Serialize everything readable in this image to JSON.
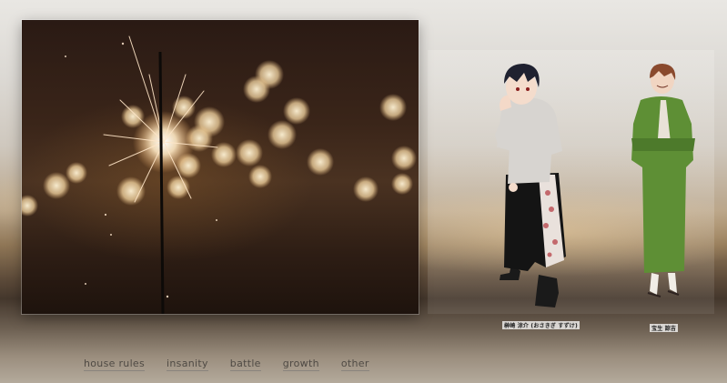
{
  "nav": {
    "items": [
      {
        "label": "house rules"
      },
      {
        "label": "insanity"
      },
      {
        "label": "battle"
      },
      {
        "label": "growth"
      },
      {
        "label": "other"
      }
    ]
  },
  "characters": [
    {
      "caption": "榊崎 涼介 (おさきぎ すずけ)",
      "image": "character-dark-hair-shorts"
    },
    {
      "caption": "宝生 諒吉",
      "image": "character-green-kimono"
    }
  ],
  "colors": {
    "nav_text": "#4f4a44",
    "kimono": "#5e8f35",
    "shirt": "#d9d6d2",
    "skirt": "#161616"
  }
}
